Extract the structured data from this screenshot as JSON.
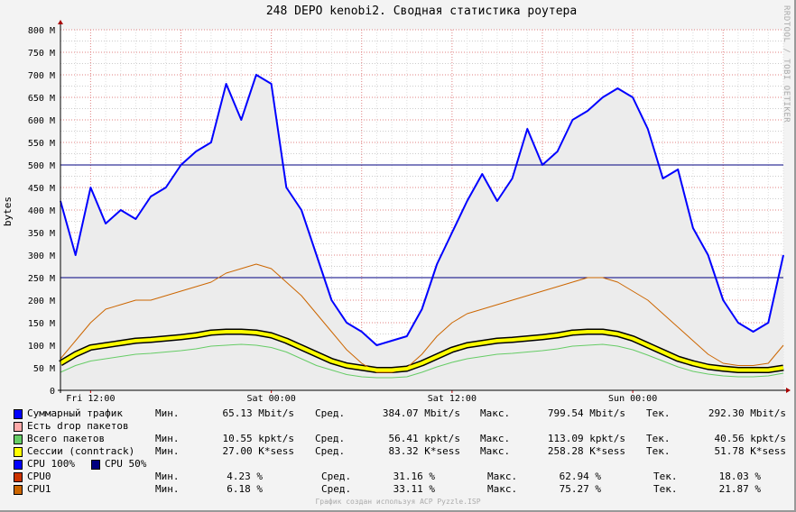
{
  "title": "248 DEPO kenobi2. Сводная статистика роутера",
  "watermark": "RRDTOOL / TOBI OETIKER",
  "footer": "График создан используя ACP Pyzzle.ISP",
  "chart_data": {
    "type": "line",
    "ylabel": "bytes",
    "ylim": [
      0,
      800
    ],
    "yticks": [
      "0",
      "50 M",
      "100 M",
      "150 M",
      "200 M",
      "250 M",
      "300 M",
      "350 M",
      "400 M",
      "450 M",
      "500 M",
      "550 M",
      "600 M",
      "650 M",
      "700 M",
      "750 M",
      "800 M"
    ],
    "xticks": [
      {
        "label": "Fri 12:00",
        "hour": 2
      },
      {
        "label": "Sat 00:00",
        "hour": 14
      },
      {
        "label": "Sat 12:00",
        "hour": 26
      },
      {
        "label": "Sun 00:00",
        "hour": 38
      }
    ],
    "x_hours": 48,
    "hlines": [
      {
        "name": "CPU 100%",
        "value": 500,
        "color": "#000080"
      },
      {
        "name": "CPU 50%",
        "value": 250,
        "color": "#000080"
      }
    ],
    "series": [
      {
        "name": "Суммарный трафик",
        "color": "#0000ff",
        "fill": "#ececec",
        "values": [
          420,
          300,
          450,
          370,
          400,
          380,
          430,
          450,
          500,
          530,
          550,
          680,
          600,
          700,
          680,
          450,
          400,
          300,
          200,
          150,
          130,
          100,
          110,
          120,
          180,
          280,
          350,
          420,
          480,
          420,
          470,
          580,
          500,
          530,
          600,
          620,
          650,
          670,
          650,
          580,
          470,
          490,
          360,
          300,
          200,
          150,
          130,
          150,
          300
        ]
      },
      {
        "name": "CPU1",
        "color": "#cc6600",
        "values": [
          70,
          110,
          150,
          180,
          190,
          200,
          200,
          210,
          220,
          230,
          240,
          260,
          270,
          280,
          270,
          240,
          210,
          170,
          130,
          90,
          60,
          40,
          40,
          50,
          80,
          120,
          150,
          170,
          180,
          190,
          200,
          210,
          220,
          230,
          240,
          250,
          250,
          240,
          220,
          200,
          170,
          140,
          110,
          80,
          60,
          55,
          55,
          60,
          100
        ]
      },
      {
        "name": "Сессии (conntrack)",
        "color": "#ffff00",
        "values": [
          60,
          80,
          95,
          100,
          105,
          110,
          112,
          115,
          118,
          122,
          128,
          130,
          130,
          128,
          122,
          110,
          95,
          80,
          65,
          55,
          50,
          45,
          45,
          48,
          60,
          75,
          90,
          100,
          105,
          110,
          112,
          115,
          118,
          122,
          128,
          130,
          130,
          125,
          115,
          100,
          85,
          70,
          60,
          52,
          48,
          45,
          45,
          45,
          50
        ]
      },
      {
        "name": "Всего пакетов",
        "color": "#66cc66",
        "values": [
          40,
          55,
          65,
          70,
          75,
          80,
          82,
          85,
          88,
          92,
          98,
          100,
          102,
          100,
          95,
          85,
          70,
          55,
          45,
          35,
          30,
          28,
          28,
          30,
          40,
          52,
          62,
          70,
          75,
          80,
          82,
          85,
          88,
          92,
          98,
          100,
          102,
          98,
          90,
          78,
          65,
          52,
          42,
          36,
          32,
          30,
          30,
          32,
          38
        ]
      }
    ]
  },
  "legend": {
    "traffic": {
      "label": "Суммарный трафик",
      "color": "#0000ff",
      "min_l": "Мин.",
      "min": "65.13 Mbit/s",
      "avg_l": "Сред.",
      "avg": "384.07 Mbit/s",
      "max_l": "Макс.",
      "max": "799.54 Mbit/s",
      "cur_l": "Тек.",
      "cur": "292.30 Mbit/s"
    },
    "drop": {
      "label": "Есть drop пакетов",
      "color": "#ffaaaa"
    },
    "packets": {
      "label": "Всего пакетов",
      "color": "#66cc66",
      "min_l": "Мин.",
      "min": "10.55 kpkt/s",
      "avg_l": "Сред.",
      "avg": "56.41 kpkt/s",
      "max_l": "Макс.",
      "max": "113.09 kpkt/s",
      "cur_l": "Тек.",
      "cur": "40.56 kpkt/s"
    },
    "sessions": {
      "label": "Сессии (conntrack)",
      "color": "#ffff00",
      "min_l": "Мин.",
      "min": "27.00 K*sess",
      "avg_l": "Сред.",
      "avg": "83.32 K*sess",
      "max_l": "Макс.",
      "max": "258.28 K*sess",
      "cur_l": "Тек.",
      "cur": "51.78 K*sess"
    },
    "cpu100": {
      "label": "CPU 100%",
      "color": "#0000ff"
    },
    "cpu50": {
      "label": "CPU 50%",
      "color": "#000080"
    },
    "cpu0": {
      "label": "CPU0",
      "color": "#cc3300",
      "min_l": "Мин.",
      "min": "4.23 %",
      "avg_l": "Сред.",
      "avg": "31.16 %",
      "max_l": "Макс.",
      "max": "62.94 %",
      "cur_l": "Тек.",
      "cur": "18.03 %"
    },
    "cpu1": {
      "label": "CPU1",
      "color": "#cc6600",
      "min_l": "Мин.",
      "min": "6.18 %",
      "avg_l": "Сред.",
      "avg": "33.11 %",
      "max_l": "Макс.",
      "max": "75.27 %",
      "cur_l": "Тек.",
      "cur": "21.87 %"
    }
  }
}
